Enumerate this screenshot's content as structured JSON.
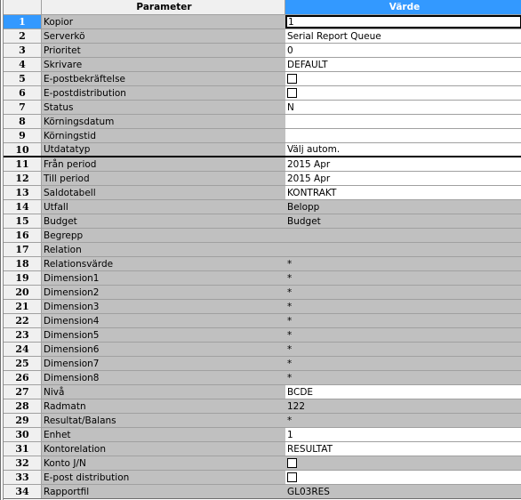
{
  "header": {
    "parameter_label": "Parameter",
    "value_label": "Värde"
  },
  "colors": {
    "accent": "#3399ff",
    "cell_grey": "#c0c0c0",
    "row_number_bg": "#f0f0f0",
    "editable_bg": "#ffffff"
  },
  "active_row": 1,
  "rows": [
    {
      "num": "1",
      "param": "Kopior",
      "value": "1",
      "type": "text",
      "editable": true,
      "focused": true
    },
    {
      "num": "2",
      "param": "Serverkö",
      "value": "Serial Report Queue",
      "type": "text",
      "editable": true
    },
    {
      "num": "3",
      "param": "Prioritet",
      "value": "0",
      "type": "text",
      "editable": true
    },
    {
      "num": "4",
      "param": "Skrivare",
      "value": "DEFAULT",
      "type": "text",
      "editable": true
    },
    {
      "num": "5",
      "param": "E-postbekräftelse",
      "value": "",
      "type": "checkbox",
      "checked": false,
      "editable": true
    },
    {
      "num": "6",
      "param": "E-postdistribution",
      "value": "",
      "type": "checkbox",
      "checked": false,
      "editable": true
    },
    {
      "num": "7",
      "param": "Status",
      "value": "N",
      "type": "text",
      "editable": true
    },
    {
      "num": "8",
      "param": "Körningsdatum",
      "value": "",
      "type": "text",
      "editable": true
    },
    {
      "num": "9",
      "param": "Körningstid",
      "value": "",
      "type": "text",
      "editable": true
    },
    {
      "num": "10",
      "param": "Utdatatyp",
      "value": "Välj autom.",
      "type": "text",
      "editable": true,
      "separator_after": true
    },
    {
      "num": "11",
      "param": "Från period",
      "value": "2015 Apr",
      "type": "text",
      "editable": true
    },
    {
      "num": "12",
      "param": "Till period",
      "value": "2015 Apr",
      "type": "text",
      "editable": true
    },
    {
      "num": "13",
      "param": "Saldotabell",
      "value": "KONTRAKT",
      "type": "text",
      "editable": true
    },
    {
      "num": "14",
      "param": "Utfall",
      "value": "Belopp",
      "type": "text",
      "editable": false
    },
    {
      "num": "15",
      "param": "Budget",
      "value": "Budget",
      "type": "text",
      "editable": false
    },
    {
      "num": "16",
      "param": "Begrepp",
      "value": "",
      "type": "text",
      "editable": false
    },
    {
      "num": "17",
      "param": "Relation",
      "value": "",
      "type": "text",
      "editable": false
    },
    {
      "num": "18",
      "param": "Relationsvärde",
      "value": "*",
      "type": "text",
      "editable": false
    },
    {
      "num": "19",
      "param": "Dimension1",
      "value": "*",
      "type": "text",
      "editable": false
    },
    {
      "num": "20",
      "param": "Dimension2",
      "value": "*",
      "type": "text",
      "editable": false
    },
    {
      "num": "21",
      "param": "Dimension3",
      "value": "*",
      "type": "text",
      "editable": false
    },
    {
      "num": "22",
      "param": "Dimension4",
      "value": "*",
      "type": "text",
      "editable": false
    },
    {
      "num": "23",
      "param": "Dimension5",
      "value": "*",
      "type": "text",
      "editable": false
    },
    {
      "num": "24",
      "param": "Dimension6",
      "value": "*",
      "type": "text",
      "editable": false
    },
    {
      "num": "25",
      "param": "Dimension7",
      "value": "*",
      "type": "text",
      "editable": false
    },
    {
      "num": "26",
      "param": "Dimension8",
      "value": "*",
      "type": "text",
      "editable": false
    },
    {
      "num": "27",
      "param": "Nivå",
      "value": "BCDE",
      "type": "text",
      "editable": true
    },
    {
      "num": "28",
      "param": "Radmatn",
      "value": "122",
      "type": "text",
      "editable": false
    },
    {
      "num": "29",
      "param": "Resultat/Balans",
      "value": "*",
      "type": "text",
      "editable": false
    },
    {
      "num": "30",
      "param": "Enhet",
      "value": "1",
      "type": "text",
      "editable": true
    },
    {
      "num": "31",
      "param": "Kontorelation",
      "value": "RESULTAT",
      "type": "text",
      "editable": true
    },
    {
      "num": "32",
      "param": "Konto J/N",
      "value": "",
      "type": "checkbox",
      "checked": false,
      "editable": false
    },
    {
      "num": "33",
      "param": "E-post distribution",
      "value": "",
      "type": "checkbox",
      "checked": false,
      "editable": true
    },
    {
      "num": "34",
      "param": "Rapportfil",
      "value": "GL03RES",
      "type": "text",
      "editable": false
    }
  ]
}
